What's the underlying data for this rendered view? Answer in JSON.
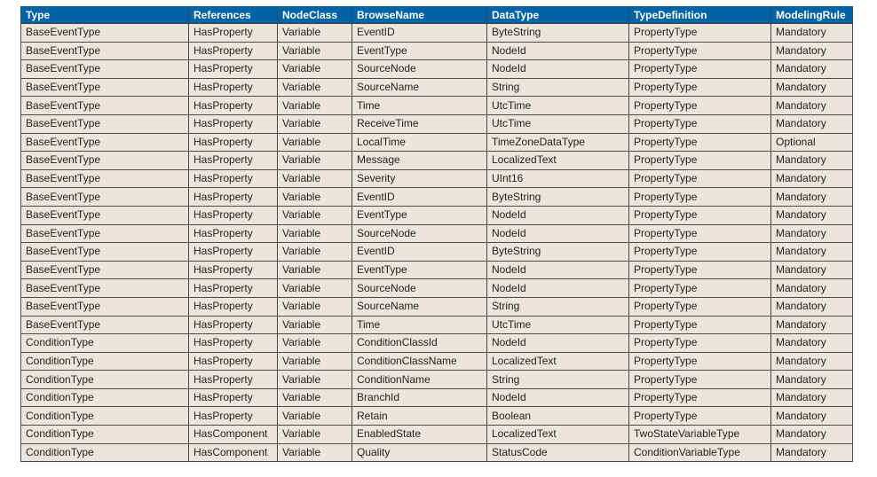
{
  "table": {
    "columns": [
      "Type",
      "References",
      "NodeClass",
      "BrowseName",
      "DataType",
      "TypeDefinition",
      "ModelingRule"
    ],
    "rows": [
      [
        "BaseEventType",
        "HasProperty",
        "Variable",
        "EventID",
        "ByteString",
        "PropertyType",
        "Mandatory"
      ],
      [
        "BaseEventType",
        "HasProperty",
        "Variable",
        "EventType",
        "NodeId",
        "PropertyType",
        "Mandatory"
      ],
      [
        "BaseEventType",
        "HasProperty",
        "Variable",
        "SourceNode",
        "NodeId",
        "PropertyType",
        "Mandatory"
      ],
      [
        "BaseEventType",
        "HasProperty",
        "Variable",
        "SourceName",
        "String",
        "PropertyType",
        "Mandatory"
      ],
      [
        "BaseEventType",
        "HasProperty",
        "Variable",
        "Time",
        "UtcTime",
        "PropertyType",
        "Mandatory"
      ],
      [
        "BaseEventType",
        "HasProperty",
        "Variable",
        "ReceiveTime",
        "UtcTime",
        "PropertyType",
        "Mandatory"
      ],
      [
        "BaseEventType",
        "HasProperty",
        "Variable",
        "LocalTime",
        "TimeZoneDataType",
        "PropertyType",
        "Optional"
      ],
      [
        "BaseEventType",
        "HasProperty",
        "Variable",
        "Message",
        "LocalizedText",
        "PropertyType",
        "Mandatory"
      ],
      [
        "BaseEventType",
        "HasProperty",
        "Variable",
        "Severity",
        "UInt16",
        "PropertyType",
        "Mandatory"
      ],
      [
        "BaseEventType",
        "HasProperty",
        "Variable",
        "EventID",
        "ByteString",
        "PropertyType",
        "Mandatory"
      ],
      [
        "BaseEventType",
        "HasProperty",
        "Variable",
        "EventType",
        "NodeId",
        "PropertyType",
        "Mandatory"
      ],
      [
        "BaseEventType",
        "HasProperty",
        "Variable",
        "SourceNode",
        "NodeId",
        "PropertyType",
        "Mandatory"
      ],
      [
        "BaseEventType",
        "HasProperty",
        "Variable",
        "EventID",
        "ByteString",
        "PropertyType",
        "Mandatory"
      ],
      [
        "BaseEventType",
        "HasProperty",
        "Variable",
        "EventType",
        "NodeId",
        "PropertyType",
        "Mandatory"
      ],
      [
        "BaseEventType",
        "HasProperty",
        "Variable",
        "SourceNode",
        "NodeId",
        "PropertyType",
        "Mandatory"
      ],
      [
        "BaseEventType",
        "HasProperty",
        "Variable",
        "SourceName",
        "String",
        "PropertyType",
        "Mandatory"
      ],
      [
        "BaseEventType",
        "HasProperty",
        "Variable",
        "Time",
        "UtcTime",
        "PropertyType",
        "Mandatory"
      ],
      [
        "ConditionType",
        "HasProperty",
        "Variable",
        "ConditionClassId",
        "NodeId",
        "PropertyType",
        "Mandatory"
      ],
      [
        "ConditionType",
        "HasProperty",
        "Variable",
        "ConditionClassName",
        "LocalizedText",
        "PropertyType",
        "Mandatory"
      ],
      [
        "ConditionType",
        "HasProperty",
        "Variable",
        "ConditionName",
        "String",
        "PropertyType",
        "Mandatory"
      ],
      [
        "ConditionType",
        "HasProperty",
        "Variable",
        "BranchId",
        "NodeId",
        "PropertyType",
        "Mandatory"
      ],
      [
        "ConditionType",
        "HasProperty",
        "Variable",
        "Retain",
        "Boolean",
        "PropertyType",
        "Mandatory"
      ],
      [
        "ConditionType",
        "HasComponent",
        "Variable",
        "EnabledState",
        "LocalizedText",
        "TwoStateVariableType",
        "Mandatory"
      ],
      [
        "ConditionType",
        "HasComponent",
        "Variable",
        "Quality",
        "StatusCode",
        "ConditionVariableType",
        "Mandatory"
      ]
    ]
  },
  "colors": {
    "header_bg": "#0063a5",
    "header_text": "#ffffff",
    "cell_bg": "#ece5dc",
    "cell_text": "#222222"
  }
}
